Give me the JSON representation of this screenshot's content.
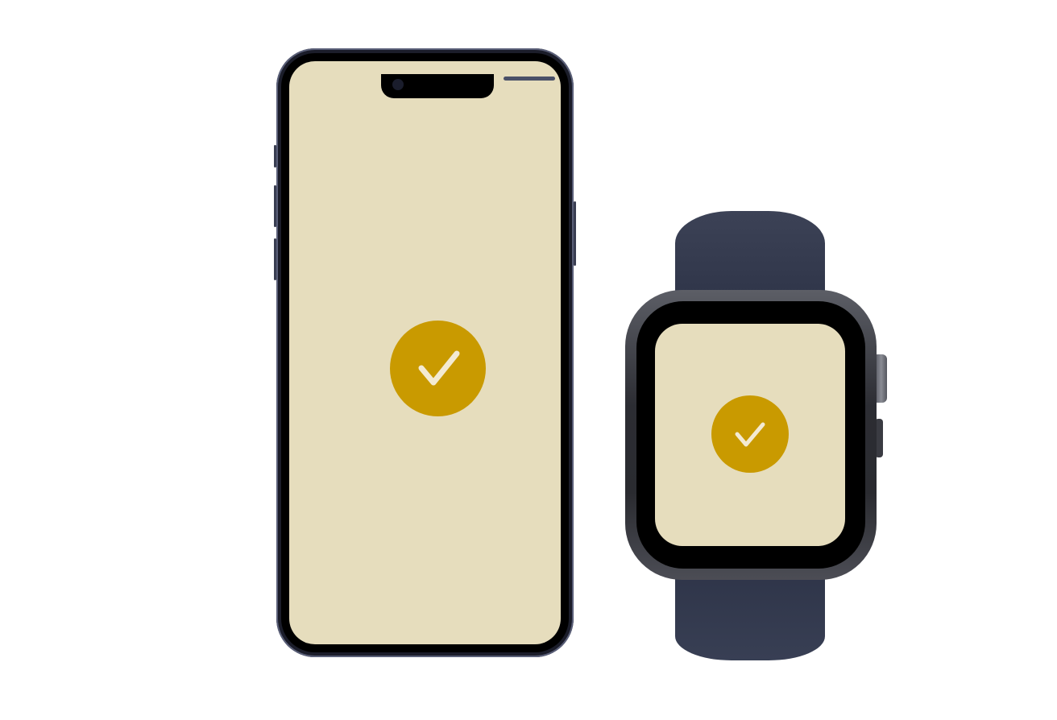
{
  "scene": {
    "devices": [
      {
        "type": "phone",
        "status": "success",
        "icon": "checkmark-icon"
      },
      {
        "type": "watch",
        "status": "success",
        "icon": "checkmark-icon"
      }
    ]
  },
  "colors": {
    "background": "#ffffff",
    "screen_background": "#e6ddbd",
    "accent": "#c99a00",
    "check_stroke": "#f3ead2",
    "phone_frame": "#1b1d2a",
    "watch_band": "#2e3448",
    "watch_case": "#2c2d33"
  }
}
